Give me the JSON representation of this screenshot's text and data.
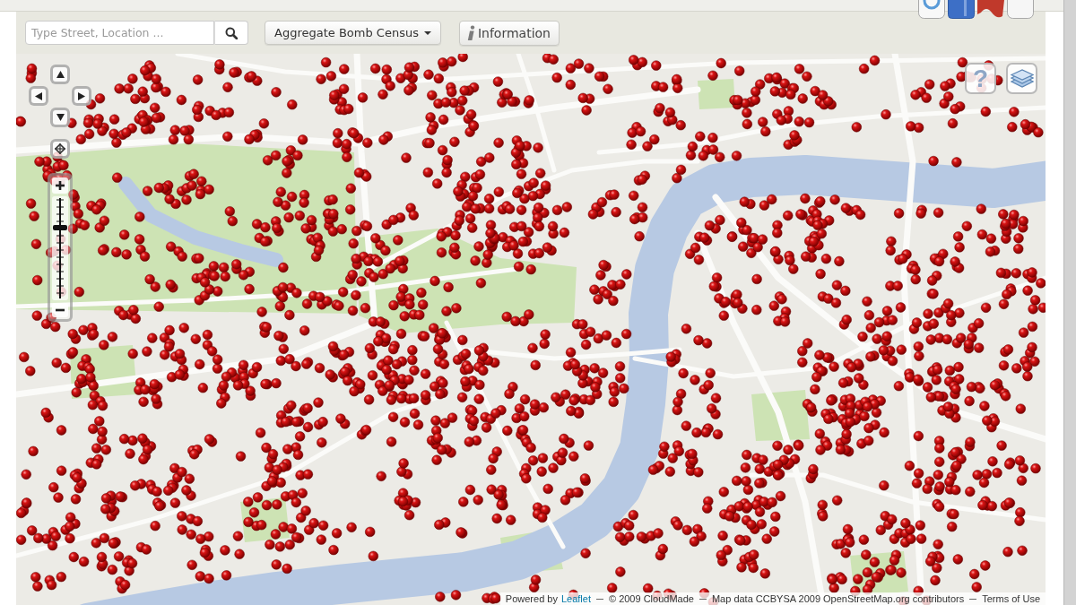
{
  "toolbar": {
    "search": {
      "placeholder": "Type Street, Location ..."
    },
    "census_menu": {
      "label": "Aggregate Bomb Census"
    },
    "info_button": {
      "label": "Information"
    }
  },
  "map": {
    "help_button": {
      "label": "?"
    },
    "zoom": {
      "level": 0.71
    }
  },
  "attribution": [
    {
      "text": "Powered by",
      "link": "Leaflet"
    },
    {
      "text": "© 2009 CloudMade"
    },
    {
      "text": "Map data CCBYSA 2009 OpenStreetMap.org contributors"
    },
    {
      "text": "Terms of Use"
    }
  ]
}
